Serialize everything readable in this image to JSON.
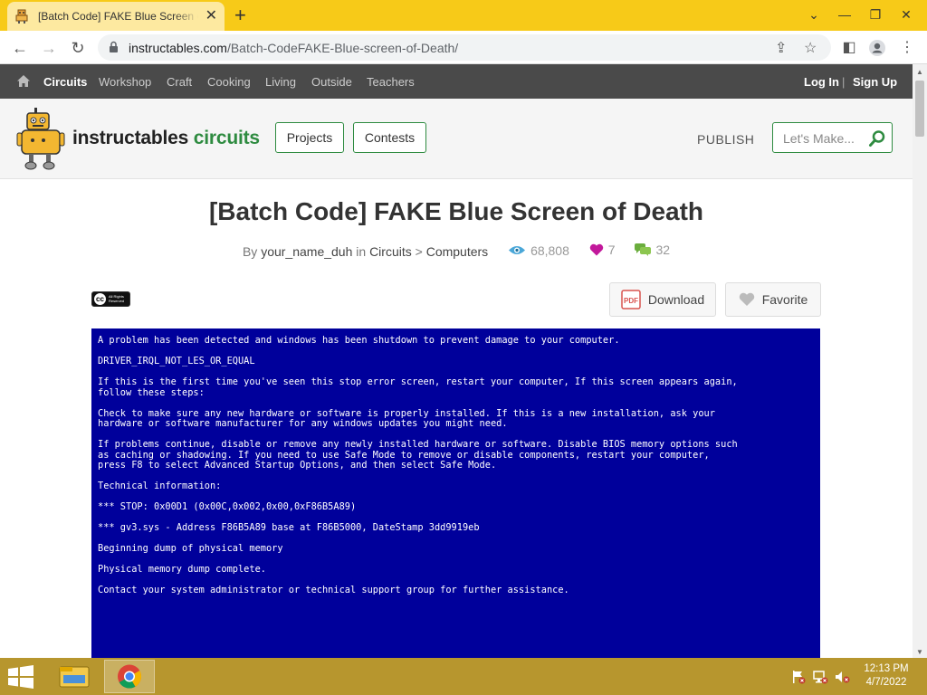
{
  "browser": {
    "tab_title": "[Batch Code] FAKE Blue Screen of Death",
    "url_domain": "instructables.com",
    "url_path": "/Batch-CodeFAKE-Blue-screen-of-Death/"
  },
  "catnav": {
    "items": [
      "Circuits",
      "Workshop",
      "Craft",
      "Cooking",
      "Living",
      "Outside",
      "Teachers"
    ],
    "login": "Log In",
    "separator": "|",
    "signup": "Sign Up"
  },
  "header": {
    "logo_main": "instructables",
    "logo_sub": "circuits",
    "projects": "Projects",
    "contests": "Contests",
    "publish": "PUBLISH",
    "search_placeholder": "Let's Make..."
  },
  "article": {
    "title": "[Batch Code] FAKE Blue Screen of Death",
    "by": "By",
    "author": "your_name_duh",
    "in": "in",
    "category": "Circuits",
    "crumb_sep": ">",
    "subcategory": "Computers",
    "views": "68,808",
    "favorites": "7",
    "comments": "32",
    "license_mark": "cc",
    "license_text": "All Rights Reserved",
    "download": "Download",
    "favorite": "Favorite",
    "pdf_label": "PDF"
  },
  "bsod": {
    "lines": [
      "A problem has been detected and windows has been shutdown to prevent damage to your computer.",
      "DRIVER_IRQL_NOT_LES_OR_EQUAL",
      "If this is the first time you've seen this stop error screen, restart your computer, If this screen appears again,\nfollow these steps:",
      "Check to make sure any new hardware or software is properly installed. If this is a new installation, ask your\nhardware or software manufacturer for any windows updates you might need.",
      "If problems continue, disable or remove any newly installed hardware or software. Disable BIOS memory options such\nas caching or shadowing. If you need to use Safe Mode to remove or disable components, restart your computer,\npress F8 to select Advanced Startup Options, and then select Safe Mode.",
      "Technical information:",
      "*** STOP: 0x00D1 (0x00C,0x002,0x00,0xF86B5A89)",
      "*** gv3.sys - Address F86B5A89 base at F86B5000, DateStamp 3dd9919eb",
      "Beginning dump of physical memory",
      "Physical memory dump complete.",
      "Contact your system administrator or technical support group for further assistance."
    ]
  },
  "taskbar": {
    "time": "12:13 PM",
    "date": "4/7/2022"
  },
  "colors": {
    "tabstrip": "#f7ca18",
    "taskbar": "#b7962e",
    "bsod_bg": "#00009b",
    "brand_green": "#2e8b40",
    "catnav_bg": "#4a4a4a"
  }
}
